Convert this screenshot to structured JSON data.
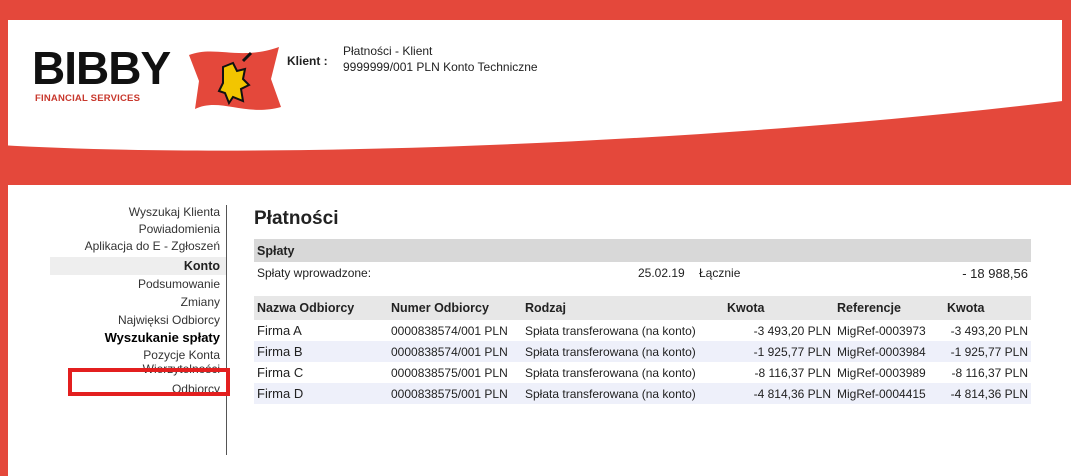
{
  "header": {
    "logo_text": "BIBBY",
    "logo_sub": "FINANCIAL SERVICES",
    "client_label": "Klient :",
    "client_line1": "Płatności - Klient",
    "client_line2": "9999999/001 PLN Konto Techniczne"
  },
  "sidebar": {
    "items_top": [
      "Wyszukaj Klienta",
      "Powiadomienia",
      "Aplikacja do E - Zgłoszeń"
    ],
    "section": "Konto",
    "items_bottom": [
      "Podsumowanie",
      "Zmiany",
      "Najwięksi Odbiorcy",
      "Wyszukanie spłaty",
      "Pozycje Konta",
      "Wierzytelności",
      "Odbiorcy"
    ]
  },
  "main": {
    "title": "Płatności",
    "panel_title": "Spłaty",
    "summary_label": "Spłaty wprowadzone:",
    "summary_date": "25.02.19",
    "summary_total_label": "Łącznie",
    "summary_total": "- 18 988,56",
    "columns": [
      "Nazwa Odbiorcy",
      "Numer Odbiorcy",
      "Rodzaj",
      "Kwota",
      "Referencje",
      "Kwota"
    ],
    "rows": [
      [
        "Firma A",
        "0000838574/001 PLN",
        "Spłata transferowana (na konto)",
        "-3 493,20 PLN",
        "MigRef-0003973",
        "-3 493,20 PLN"
      ],
      [
        "Firma B",
        "0000838574/001 PLN",
        "Spłata transferowana (na konto)",
        "-1 925,77 PLN",
        "MigRef-0003984",
        "-1 925,77 PLN"
      ],
      [
        "Firma C",
        "0000838575/001 PLN",
        "Spłata transferowana (na konto)",
        "-8 116,37 PLN",
        "MigRef-0003989",
        "-8 116,37 PLN"
      ],
      [
        "Firma D",
        "0000838575/001 PLN",
        "Spłata transferowana (na konto)",
        "-4 814,36 PLN",
        "MigRef-0004415",
        "-4 814,36 PLN"
      ]
    ]
  },
  "colors": {
    "brand_red": "#e4483b",
    "highlight_red": "#e31f1f"
  }
}
